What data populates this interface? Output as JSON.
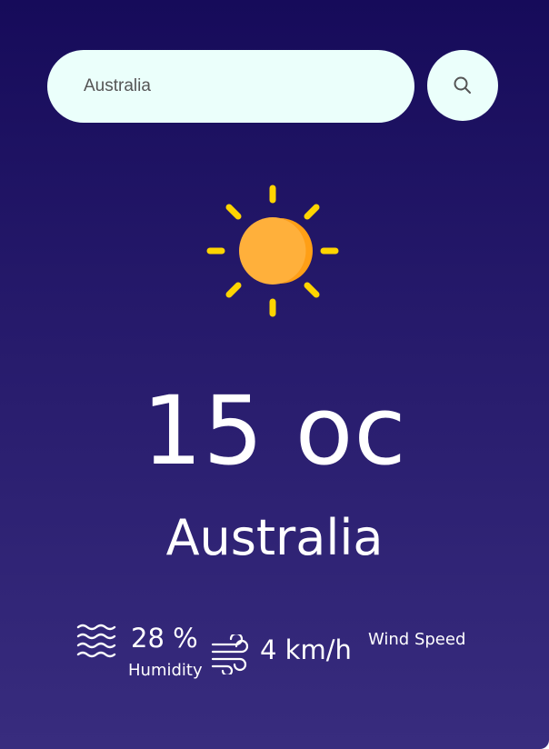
{
  "search": {
    "value": "Australia",
    "icon": "search-icon"
  },
  "weather": {
    "icon": "sun-icon",
    "temperature": "15 oc",
    "city": "Australia"
  },
  "humidity": {
    "icon": "humidity-icon",
    "value": "28 %",
    "label": "Humidity"
  },
  "wind": {
    "icon": "wind-icon",
    "value": "4 km/h",
    "label": "Wind Speed"
  },
  "colors": {
    "background_top": "#160b5a",
    "background_bottom": "#382c7e",
    "search_background": "#ebfffb",
    "sun_ray": "#ffd400",
    "sun_body": "#ffb03b",
    "text": "#ffffff"
  }
}
